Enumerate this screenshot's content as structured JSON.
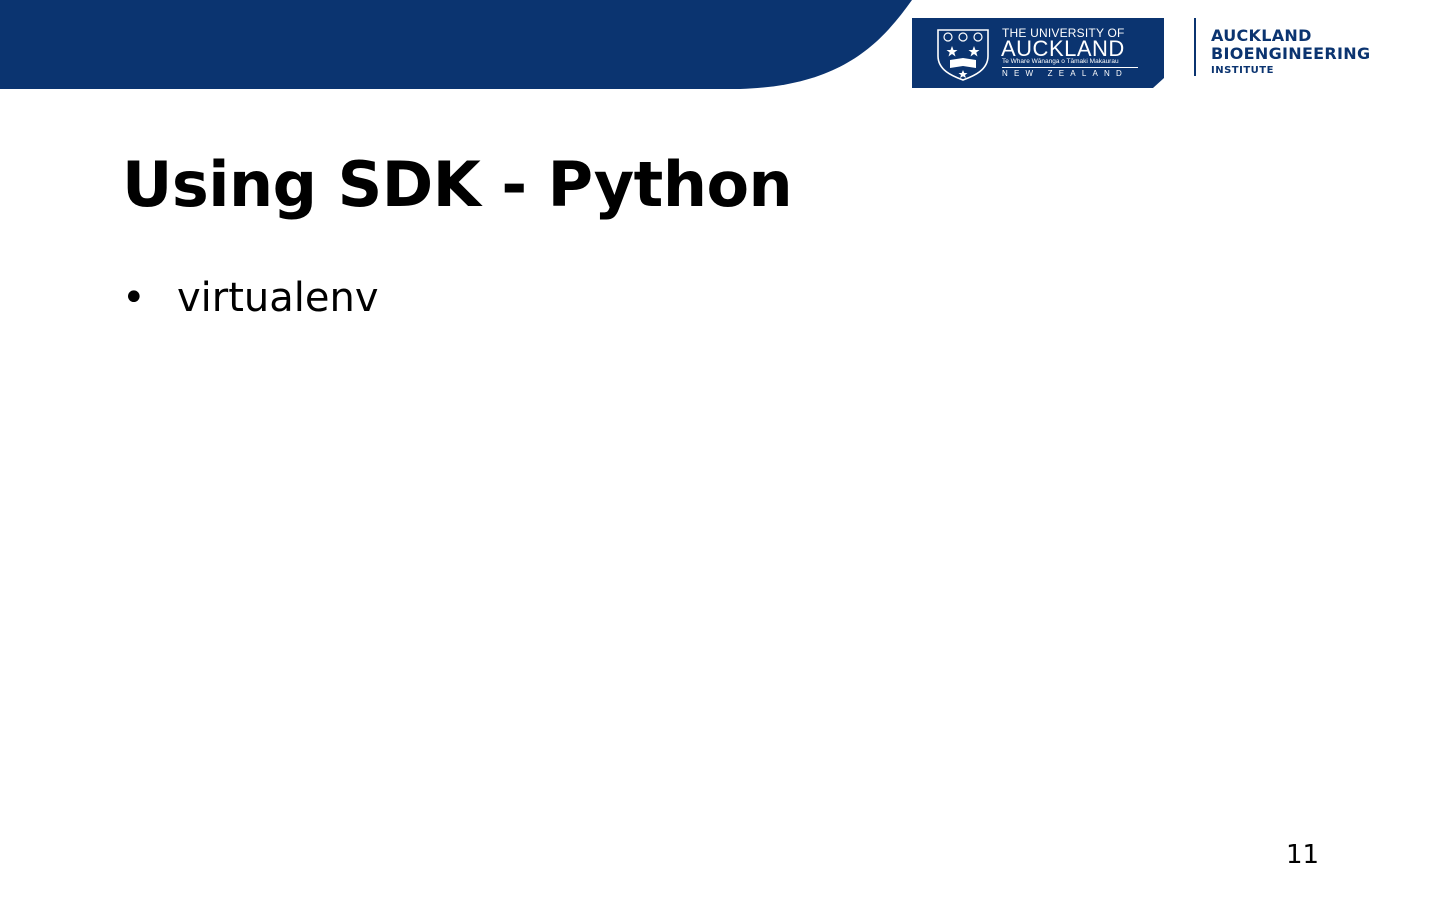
{
  "colors": {
    "brand_navy": "#0b3470",
    "background": "#ffffff",
    "text": "#000000"
  },
  "header": {
    "university_logo": {
      "line1": "THE UNIVERSITY OF",
      "line2": "AUCKLAND",
      "line3": "Te Whare Wānanga o Tāmaki Makaurau",
      "line4": "NEW ZEALAND",
      "crest_icon": "university-crest-icon"
    },
    "institute_logo": {
      "line1": "AUCKLAND",
      "line2": "BIOENGINEERING",
      "line3": "INSTITUTE"
    }
  },
  "slide": {
    "title": "Using SDK - Python",
    "bullets": [
      {
        "marker": "•",
        "text": "virtualenv"
      }
    ],
    "page_number": "11"
  }
}
